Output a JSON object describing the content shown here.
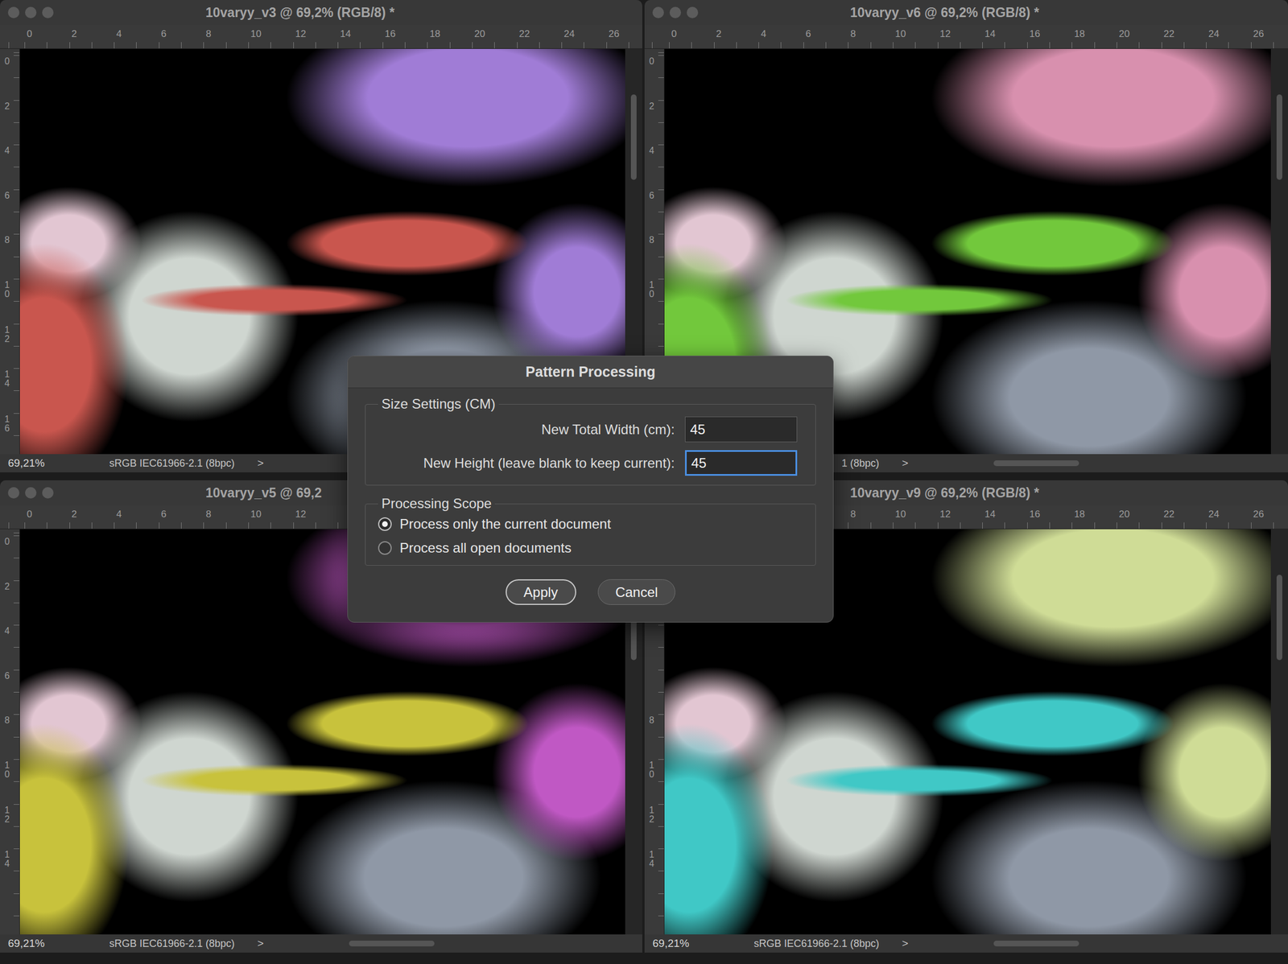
{
  "windows": [
    {
      "title": "10varyy_v3 @ 69,2% (RGB/8) *",
      "ruler_top": [
        "0",
        "2",
        "4",
        "6",
        "8",
        "10",
        "12",
        "14",
        "16",
        "18",
        "20",
        "22",
        "24",
        "26"
      ],
      "ruler_left": [
        "0",
        "2",
        "4",
        "6",
        "8",
        "10",
        "12",
        "14",
        "16"
      ],
      "zoom": "69,21%",
      "profile": "sRGB IEC61966-2.1 (8bpc)",
      "arrow": ">",
      "color": "#c9564e",
      "color2": "#a07cd6"
    },
    {
      "title": "10varyy_v6 @ 69,2% (RGB/8) *",
      "ruler_top": [
        "0",
        "2",
        "4",
        "6",
        "8",
        "10",
        "12",
        "14",
        "16",
        "18",
        "20",
        "22",
        "24",
        "26"
      ],
      "ruler_left": [
        "0",
        "2",
        "4",
        "6",
        "8",
        "10"
      ],
      "zoom": "",
      "profile": "1 (8bpc)",
      "arrow": ">",
      "color": "#72c83c",
      "color2": "#d890ae"
    },
    {
      "title": "10varyy_v5 @ 69,2",
      "ruler_top": [
        "0",
        "2",
        "4",
        "6",
        "8",
        "10",
        "12"
      ],
      "ruler_left": [
        "0",
        "2",
        "4",
        "6",
        "8",
        "10",
        "12",
        "14"
      ],
      "zoom": "69,21%",
      "profile": "sRGB IEC61966-2.1 (8bpc)",
      "arrow": ">",
      "color": "#c8c23c",
      "color2": "#c058c4"
    },
    {
      "title": "10varyy_v9 @ 69,2% (RGB/8) *",
      "ruler_top": [
        "8",
        "10",
        "12",
        "14",
        "16",
        "18",
        "20",
        "22",
        "24",
        "26"
      ],
      "ruler_left": [
        "8",
        "10",
        "12",
        "14"
      ],
      "zoom": "69,21%",
      "profile": "sRGB IEC61966-2.1 (8bpc)",
      "arrow": ">",
      "color": "#40c8c6",
      "color2": "#cfdc96"
    }
  ],
  "dialog": {
    "title": "Pattern Processing",
    "size_group": {
      "legend": "Size Settings (CM)",
      "fields": [
        {
          "label": "New Total Width (cm):",
          "value": "45",
          "focused": false
        },
        {
          "label": "New Height (leave blank to keep current):",
          "value": "45",
          "focused": true
        }
      ]
    },
    "scope_group": {
      "legend": "Processing Scope",
      "options": [
        {
          "label": "Process only the current document",
          "selected": true
        },
        {
          "label": "Process all open documents",
          "selected": false
        }
      ]
    },
    "buttons": [
      {
        "label": "Apply",
        "default": true
      },
      {
        "label": "Cancel",
        "default": false
      }
    ]
  }
}
